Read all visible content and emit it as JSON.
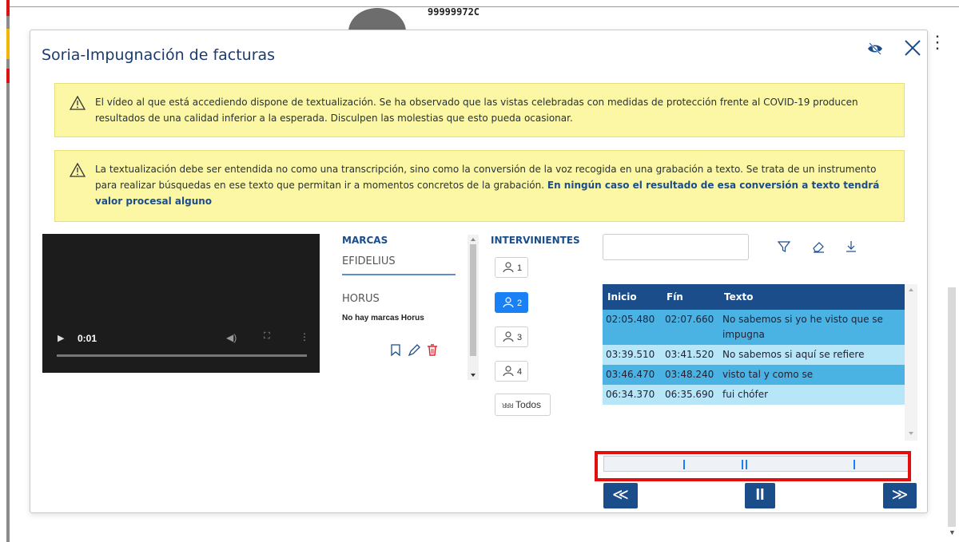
{
  "background": {
    "user_code": "99999972C"
  },
  "modal": {
    "title": "Soria-Impugnación de facturas",
    "alert1_text": "El vídeo al que está accediendo dispone de textualización. Se ha observado que las vistas celebradas con medidas de protección frente al COVID-19 producen resultados de una calidad inferior a la esperada. Disculpen las molestias que esto pueda ocasionar.",
    "alert2_text": "La textualización debe ser entendida no como una transcripción, sino como la conversión de la voz recogida en una grabación a texto. Se trata de un instrumento para realizar búsquedas en ese texto que permitan ir a momentos concretos de la grabación.",
    "alert2_strong": "En ningún caso el resultado de esa conversión a texto tendrá valor procesal alguno"
  },
  "video": {
    "time": "0:01"
  },
  "marcas": {
    "title": "MARCAS",
    "efidelius": "EFIDELIUS",
    "horus": "HORUS",
    "no_marks": "No hay marcas Horus"
  },
  "intervinientes": {
    "title": "INTERVINIENTES",
    "speakers": [
      "1",
      "2",
      "3",
      "4"
    ],
    "active_speaker": "2",
    "todos": "Todos"
  },
  "search": {
    "value": ""
  },
  "transcript": {
    "headers": [
      "Inicio",
      "Fín",
      "Texto"
    ],
    "rows": [
      {
        "start": "02:05.480",
        "end": "02:07.660",
        "text": "No sabemos si yo he visto que se impugna"
      },
      {
        "start": "03:39.510",
        "end": "03:41.520",
        "text": "No sabemos si aquí se refiere"
      },
      {
        "start": "03:46.470",
        "end": "03:48.240",
        "text": "visto tal y como se"
      },
      {
        "start": "06:34.370",
        "end": "06:35.690",
        "text": "fui chófer"
      }
    ]
  },
  "player_nav": {
    "prev": "≪",
    "pause": "II",
    "next": "≫"
  },
  "colors": {
    "primary": "#1b4d8a",
    "active": "#1a80f5",
    "alert_bg": "#fbf7a5",
    "row_dark": "#4bb3e4",
    "row_light": "#b8e6f9",
    "highlight": "#e30e0e"
  }
}
